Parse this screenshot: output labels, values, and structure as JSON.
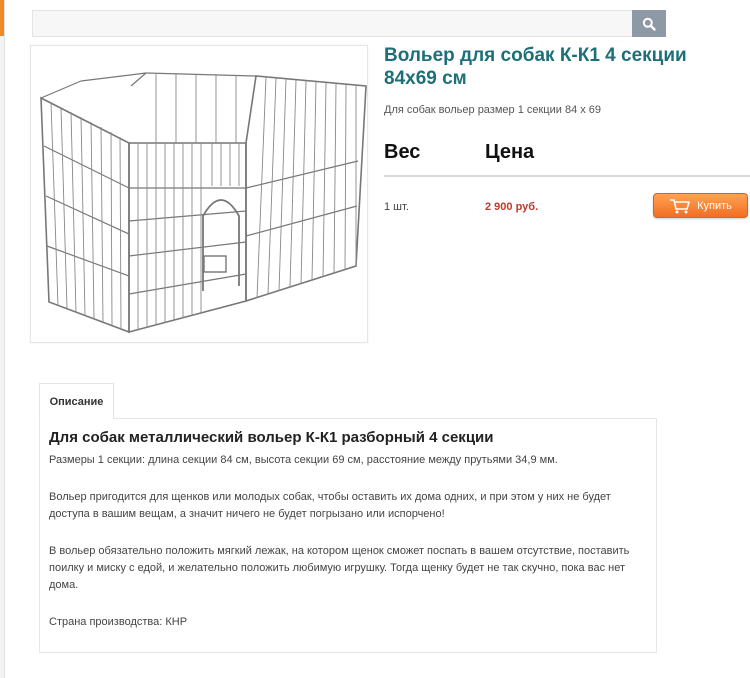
{
  "search": {
    "placeholder": "",
    "icon": "search-icon"
  },
  "product": {
    "title": "Вольер для собак К-К1 4 секции 84х69 см",
    "subtitle": "Для собак вольер размер 1 секции 84 х 69",
    "image_alt": "metal-dog-pen-image"
  },
  "purchase": {
    "weight_header": "Вес",
    "price_header": "Цена",
    "quantity": "1 шт.",
    "price": "2 900 руб.",
    "buy_label": "Купить",
    "buy_icon": "cart-icon"
  },
  "tabs": [
    {
      "label": "Описание"
    }
  ],
  "description": {
    "heading": "Для собак металлический вольер К-К1 разборный 4 секции",
    "paragraphs": [
      "Размеры 1 секции: длина секции 84 см, высота секции 69 см, расстояние между прутьями 34,9 мм.",
      "Вольер пригодится для щенков или молодых собак, чтобы оставить их дома одних, и при этом у них не будет доступа в вашим вещам, а значит ничего не будет погрызано или испорчено!",
      "В вольер обязательно положить мягкий лежак, на котором щенок сможет поспать в вашем отсутствие, поставить поилку и миску с едой, и желательно положить любимую игрушку. Тогда щенку будет не так скучно, пока вас нет дома.",
      "Страна производства: КНР"
    ]
  },
  "colors": {
    "title": "#1d6f7a",
    "price": "#c0392b",
    "buy_button": "#f26e22",
    "search_button": "#8d9aa5"
  }
}
